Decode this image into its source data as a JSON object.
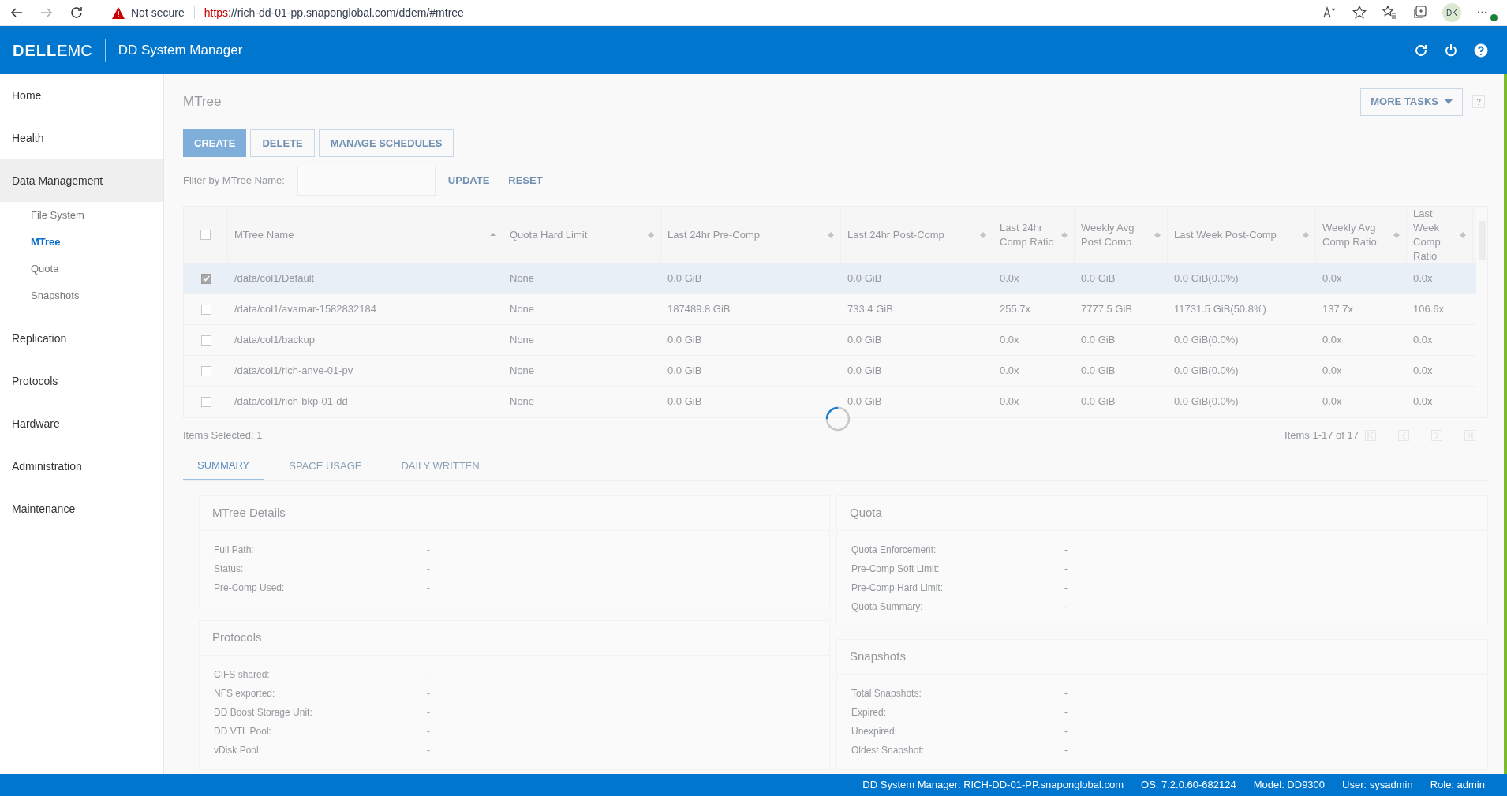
{
  "browser": {
    "security": "Not secure",
    "url_scheme": "https",
    "url_rest": "://rich-dd-01-pp.snaponglobal.com/ddem/#mtree",
    "profile": "DK",
    "more": "···"
  },
  "header": {
    "logo_a": "DELL",
    "logo_b": "EMC",
    "title": "DD System Manager"
  },
  "sidebar": {
    "items": [
      {
        "label": "Home",
        "selected": false
      },
      {
        "label": "Health",
        "selected": false
      },
      {
        "label": "Data Management",
        "selected": true,
        "children": [
          {
            "label": "File System",
            "selected": false
          },
          {
            "label": "MTree",
            "selected": true
          },
          {
            "label": "Quota",
            "selected": false
          },
          {
            "label": "Snapshots",
            "selected": false
          }
        ]
      },
      {
        "label": "Replication",
        "selected": false
      },
      {
        "label": "Protocols",
        "selected": false
      },
      {
        "label": "Hardware",
        "selected": false
      },
      {
        "label": "Administration",
        "selected": false
      },
      {
        "label": "Maintenance",
        "selected": false
      }
    ]
  },
  "page": {
    "title": "MTree",
    "more_tasks": "MORE TASKS",
    "help": "?",
    "buttons": [
      {
        "label": "CREATE",
        "kind": "primary"
      },
      {
        "label": "DELETE",
        "kind": "outline"
      },
      {
        "label": "MANAGE SCHEDULES",
        "kind": "outline"
      }
    ],
    "filter": {
      "label": "Filter by MTree Name:",
      "update": "UPDATE",
      "reset": "RESET"
    },
    "table": {
      "select_all_checked": false,
      "columns": [
        {
          "label": "MTree Name",
          "sorted": true
        },
        {
          "label": "Quota Hard Limit",
          "sorted": false
        },
        {
          "label": "Last 24hr Pre-Comp",
          "sorted": false
        },
        {
          "label": "Last 24hr Post-Comp",
          "sorted": false
        },
        {
          "label": "Last 24hr Comp Ratio",
          "sorted": false
        },
        {
          "label": "Weekly Avg Post Comp",
          "sorted": false
        },
        {
          "label": "Last Week Post-Comp",
          "sorted": false
        },
        {
          "label": "Weekly Avg Comp Ratio",
          "sorted": false
        },
        {
          "label": "Last Week Comp Ratio",
          "sorted": false
        }
      ],
      "rows": [
        {
          "selected": true,
          "cells": [
            "/data/col1/Default",
            "None",
            "0.0 GiB",
            "0.0 GiB",
            "0.0x",
            "0.0 GiB",
            "0.0 GiB(0.0%)",
            "0.0x",
            "0.0x"
          ]
        },
        {
          "selected": false,
          "cells": [
            "/data/col1/avamar-1582832184",
            "None",
            "187489.8 GiB",
            "733.4 GiB",
            "255.7x",
            "7777.5 GiB",
            "11731.5 GiB(50.8%)",
            "137.7x",
            "106.6x"
          ]
        },
        {
          "selected": false,
          "cells": [
            "/data/col1/backup",
            "None",
            "0.0 GiB",
            "0.0 GiB",
            "0.0x",
            "0.0 GiB",
            "0.0 GiB(0.0%)",
            "0.0x",
            "0.0x"
          ]
        },
        {
          "selected": false,
          "cells": [
            "/data/col1/rich-anve-01-pv",
            "None",
            "0.0 GiB",
            "0.0 GiB",
            "0.0x",
            "0.0 GiB",
            "0.0 GiB(0.0%)",
            "0.0x",
            "0.0x"
          ]
        },
        {
          "selected": false,
          "cells": [
            "/data/col1/rich-bkp-01-dd",
            "None",
            "0.0 GiB",
            "0.0 GiB",
            "0.0x",
            "0.0 GiB",
            "0.0 GiB(0.0%)",
            "0.0x",
            "0.0x"
          ]
        }
      ],
      "items_selected": "Items Selected: 1",
      "pagination": "Items 1-17 of 17"
    },
    "tabs": [
      {
        "label": "SUMMARY",
        "selected": true
      },
      {
        "label": "SPACE USAGE",
        "selected": false
      },
      {
        "label": "DAILY WRITTEN",
        "selected": false
      }
    ],
    "panels_left": [
      {
        "title": "MTree Details",
        "rows": [
          [
            "Full Path:",
            "-"
          ],
          [
            "Status:",
            "-"
          ],
          [
            "Pre-Comp Used:",
            "-"
          ]
        ]
      },
      {
        "title": "Protocols",
        "rows": [
          [
            "CIFS shared:",
            "-"
          ],
          [
            "NFS exported:",
            "-"
          ],
          [
            "DD Boost Storage Unit:",
            "-"
          ],
          [
            "DD VTL Pool:",
            "-"
          ],
          [
            "vDisk Pool:",
            "-"
          ]
        ]
      }
    ],
    "panels_right": [
      {
        "title": "Quota",
        "rows": [
          [
            "Quota Enforcement:",
            "-"
          ],
          [
            "Pre-Comp Soft Limit:",
            "-"
          ],
          [
            "Pre-Comp Hard Limit:",
            "-"
          ],
          [
            "Quota Summary:",
            "-"
          ]
        ]
      },
      {
        "title": "Snapshots",
        "rows": [
          [
            "Total Snapshots:",
            "-"
          ],
          [
            "Expired:",
            "-"
          ],
          [
            "Unexpired:",
            "-"
          ],
          [
            "Oldest Snapshot:",
            "-"
          ]
        ]
      }
    ]
  },
  "status_bar": [
    "DD System Manager: RICH-DD-01-PP.snaponglobal.com",
    "OS: 7.2.0.60-682124",
    "Model: DD9300",
    "User: sysadmin",
    "Role: admin"
  ]
}
